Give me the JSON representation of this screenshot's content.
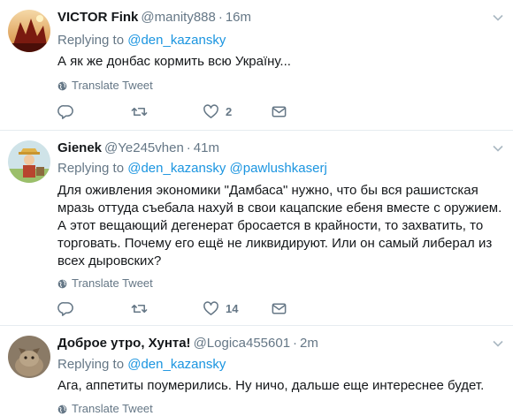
{
  "tweets": [
    {
      "name": "VICTOR Fink",
      "handle": "@manity888",
      "dot": "·",
      "time": "16m",
      "replying_label": "Replying to",
      "mentions": "@den_kazansky",
      "text": "А як же донбас кормить всю Україну...",
      "translate_label": "Translate Tweet",
      "likes": "2"
    },
    {
      "name": "Gienek",
      "handle": "@Ye245vhen",
      "dot": "·",
      "time": "41m",
      "replying_label": "Replying to",
      "mentions": "@den_kazansky @pawlushkaserj",
      "text": "Для оживления экономики \"Дамбаса\" нужно, что бы вся рашистская мразь оттуда съебала нахуй в свои кацапские ебеня вместе с оружием. А этот вещающий дегенерат бросается в крайности, то захватить, то торговать. Почему его ещё не ликвидируют. Или он самый либерал из всех дыровских?",
      "translate_label": "Translate Tweet",
      "likes": "14"
    },
    {
      "name": "Доброе утро, Хунта!",
      "handle": "@Logica455601",
      "dot": "·",
      "time": "2m",
      "replying_label": "Replying to",
      "mentions": "@den_kazansky",
      "text": "Ага, аппетиты поумерились. Ну ничо, дальше еще интереснее будет.",
      "translate_label": "Translate Tweet"
    }
  ],
  "colors": {
    "link": "#1b95e0",
    "secondary": "#657786",
    "border": "#e6ecf0"
  },
  "icons": [
    "reply-icon",
    "retweet-icon",
    "like-icon",
    "dm-icon",
    "globe-icon",
    "caret-down-icon"
  ]
}
